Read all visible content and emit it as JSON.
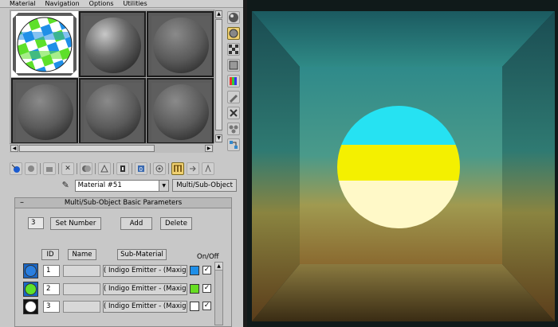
{
  "menu": [
    "Material",
    "Navigation",
    "Options",
    "Utilities"
  ],
  "material_name": "Material #51",
  "material_type": "Multi/Sub-Object",
  "rollout": {
    "title": "Multi/Sub-Object Basic Parameters",
    "count": "3",
    "set_number": "Set Number",
    "add": "Add",
    "delete": "Delete",
    "col_id": "ID",
    "col_name": "Name",
    "col_sub": "Sub-Material",
    "col_onoff": "On/Off"
  },
  "submaterials": [
    {
      "id": "1",
      "name": "",
      "material": "( Indigo Emitter - (Maxigo) )",
      "color": "#1f8fe8",
      "swatch": "#2a7fe0",
      "on": "✓"
    },
    {
      "id": "2",
      "name": "",
      "material": "( Indigo Emitter - (Maxigo) )",
      "color": "#66dd22",
      "swatch": "#5ee02a",
      "on": "✓"
    },
    {
      "id": "3",
      "name": "",
      "material": "( Indigo Emitter - (Maxigo) )",
      "color": "#ffffff",
      "swatch": "#ffffff",
      "on": "✓"
    }
  ],
  "icons": {
    "side": [
      "sphere-icon",
      "backlight-icon",
      "checker-background-icon",
      "uv-tiling-icon",
      "video-color-check-icon",
      "make-preview-icon",
      "options-icon",
      "select-by-material-icon",
      "material-map-navigator-icon"
    ],
    "toolbar": [
      "get-material-icon",
      "put-to-scene-icon",
      "assign-to-selection-icon",
      "reset-icon",
      "make-unique-icon",
      "put-to-library-icon",
      "material-id-channel-icon",
      "show-map-in-viewport-icon",
      "show-end-result-icon",
      "go-to-parent-icon",
      "go-forward-to-sibling-icon"
    ]
  },
  "render_colors": {
    "top_band": "#26e2f2",
    "middle_band": "#f4f000",
    "bottom_band": "#fff9c8"
  }
}
